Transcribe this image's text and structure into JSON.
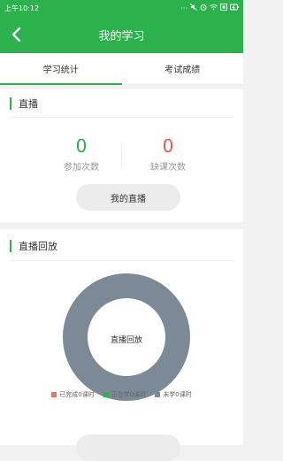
{
  "status_bar": {
    "time": "上午10:12",
    "icons": [
      "more-dots-icon",
      "mute-icon",
      "alarm-icon",
      "wifi-icon",
      "sim-icon",
      "battery-icon"
    ]
  },
  "header": {
    "title": "我的学习",
    "back_icon": "back-arrow-icon"
  },
  "tabs": [
    {
      "label": "学习统计",
      "active": true
    },
    {
      "label": "考试成绩",
      "active": false
    }
  ],
  "live_section": {
    "title": "直播",
    "attend": {
      "value": "0",
      "label": "参加次数",
      "color": "#2bb24c"
    },
    "absent": {
      "value": "0",
      "label": "缺课次数",
      "color": "#e85a4f"
    },
    "button_label": "我的直播"
  },
  "replay_section": {
    "title": "直播回放",
    "chart_center_label": "直播回放"
  },
  "chart_data": {
    "type": "pie",
    "categories": [
      "已完成0课时",
      "正在学0课时",
      "未学0课时"
    ],
    "values": [
      0,
      0,
      0
    ],
    "colors": [
      "#e27a6a",
      "#2bb24c",
      "#7b8a96"
    ],
    "title": "",
    "donut": true,
    "legend": "bottom"
  },
  "colors": {
    "accent": "#2bb24c",
    "red": "#e85a4f",
    "donut_empty": "#7b8a96"
  }
}
